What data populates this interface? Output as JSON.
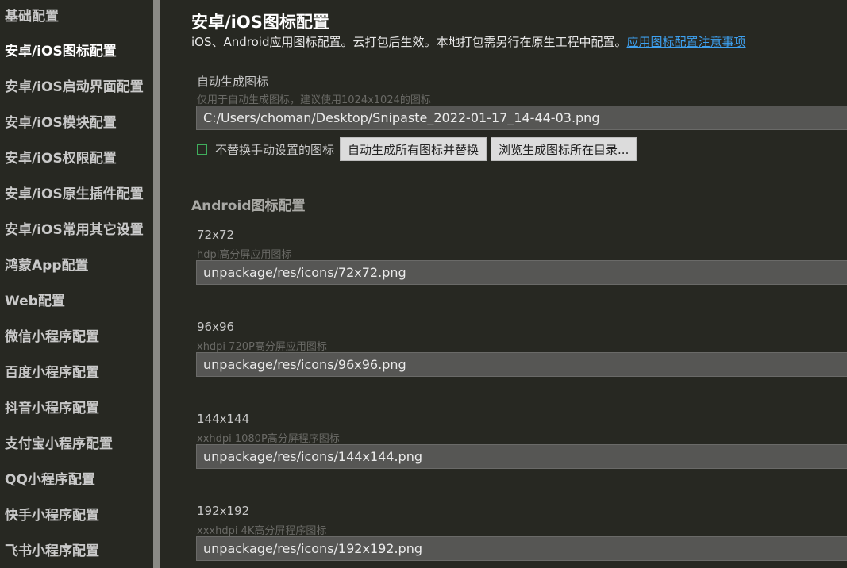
{
  "sidebar": {
    "items": [
      {
        "label": "基础配置"
      },
      {
        "label": "安卓/iOS图标配置"
      },
      {
        "label": "安卓/iOS启动界面配置"
      },
      {
        "label": "安卓/iOS模块配置"
      },
      {
        "label": "安卓/iOS权限配置"
      },
      {
        "label": "安卓/iOS原生插件配置"
      },
      {
        "label": "安卓/iOS常用其它设置"
      },
      {
        "label": "鸿蒙App配置"
      },
      {
        "label": "Web配置"
      },
      {
        "label": "微信小程序配置"
      },
      {
        "label": "百度小程序配置"
      },
      {
        "label": "抖音小程序配置"
      },
      {
        "label": "支付宝小程序配置"
      },
      {
        "label": "QQ小程序配置"
      },
      {
        "label": "快手小程序配置"
      },
      {
        "label": "飞书小程序配置"
      }
    ],
    "active_index": 1
  },
  "main": {
    "title": "安卓/iOS图标配置",
    "description": "iOS、Android应用图标配置。云打包后生效。本地打包需另行在原生工程中配置。",
    "description_link": "应用图标配置注意事项",
    "auto": {
      "label": "自动生成图标",
      "hint": "仅用于自动生成图标，建议使用1024x1024的图标",
      "value": "C:/Users/choman/Desktop/Snipaste_2022-01-17_14-44-03.png",
      "checkbox_label": "不替换手动设置的图标",
      "checkbox_checked": false,
      "generate_button": "自动生成所有图标并替换",
      "browse_button": "浏览生成图标所在目录..."
    },
    "android_section_title": "Android图标配置",
    "icons": [
      {
        "label": "72x72",
        "hint": "hdpi高分屏应用图标",
        "value": "unpackage/res/icons/72x72.png"
      },
      {
        "label": "96x96",
        "hint": "xhdpi 720P高分屏应用图标",
        "value": "unpackage/res/icons/96x96.png"
      },
      {
        "label": "144x144",
        "hint": "xxhdpi 1080P高分屏程序图标",
        "value": "unpackage/res/icons/144x144.png"
      },
      {
        "label": "192x192",
        "hint": "xxxhdpi 4K高分屏程序图标",
        "value": "unpackage/res/icons/192x192.png"
      }
    ]
  },
  "colors": {
    "background": "#272822",
    "link": "#3ea1f0",
    "checkbox_border": "#3fae5c"
  }
}
